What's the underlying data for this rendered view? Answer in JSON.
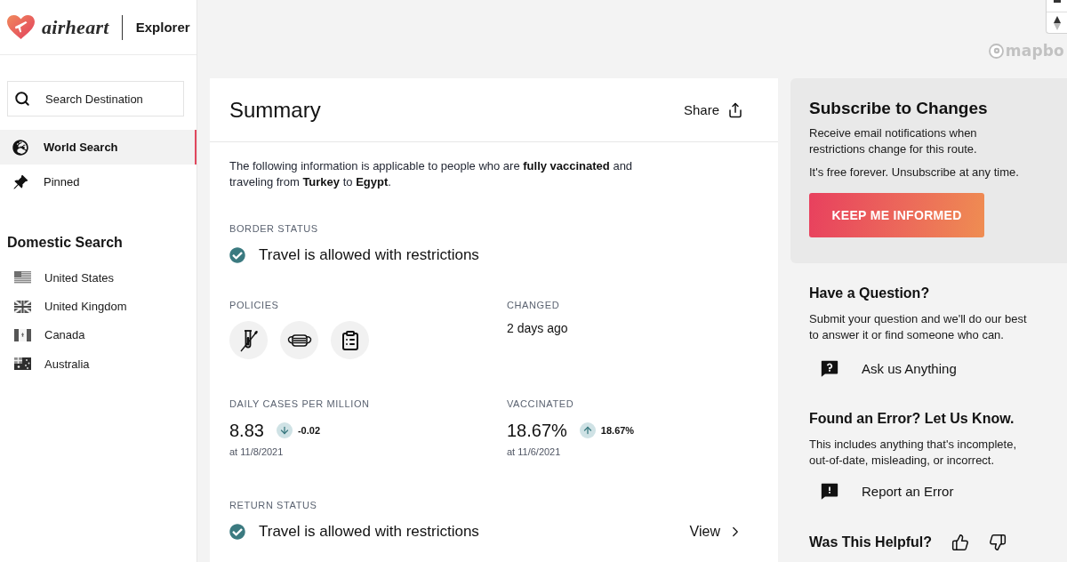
{
  "sidebar": {
    "logo": {
      "wordmark": "airheart",
      "product": "Explorer"
    },
    "search": {
      "placeholder": "Search Destination"
    },
    "nav": [
      {
        "kind": "globe",
        "label": "World Search",
        "selected": true
      },
      {
        "kind": "pin",
        "label": "Pinned",
        "selected": false
      }
    ],
    "domestic": {
      "title": "Domestic Search",
      "items": [
        {
          "kind": "us",
          "label": "United States"
        },
        {
          "kind": "uk",
          "label": "United Kingdom"
        },
        {
          "kind": "canada",
          "label": "Canada"
        },
        {
          "kind": "australia",
          "label": "Australia"
        }
      ]
    }
  },
  "map": {
    "attribution": "mapbo"
  },
  "summary": {
    "title": "Summary",
    "share": "Share",
    "intro": "The following information is applicable to people who are **fully vaccinated** and traveling from **Turkey** to **Egypt**.",
    "border_status": {
      "label": "BORDER STATUS",
      "status": "Travel is allowed with restrictions"
    },
    "policies": {
      "label": "POLICIES",
      "items": [
        {
          "kind": "test"
        },
        {
          "kind": "mask"
        },
        {
          "kind": "form"
        }
      ]
    },
    "changed": {
      "label": "CHANGED",
      "value": "2 days ago"
    },
    "stats": [
      {
        "label": "DAILY CASES PER MILLION",
        "value": "8.83",
        "rising": false,
        "change": "-0.02",
        "date": "at 11/8/2021"
      },
      {
        "label": "VACCINATED",
        "value": "18.67%",
        "rising": true,
        "change": "18.67%",
        "date": "at 11/6/2021"
      }
    ],
    "return_status": {
      "label": "RETURN STATUS",
      "status": "Travel is allowed with restrictions",
      "action": "View"
    }
  },
  "subscribe": {
    "title": "Subscribe to Changes",
    "text": "Receive email notifications when restrictions change for this route.",
    "note": "It's free forever. Unsubscribe at any time.",
    "button": "KEEP ME INFORMED"
  },
  "help": [
    {
      "kind": "question",
      "title": "Have a Question?",
      "text": "Submit your question and we'll do our best to answer it or find someone who can.",
      "action": "Ask us Anything"
    },
    {
      "kind": "error",
      "title": "Found an Error? Let Us Know.",
      "text": "This includes anything that's incomplete, out-of-date, misleading, or incorrect.",
      "action": "Report an Error"
    }
  ],
  "feedback": {
    "title": "Was This Helpful?"
  }
}
